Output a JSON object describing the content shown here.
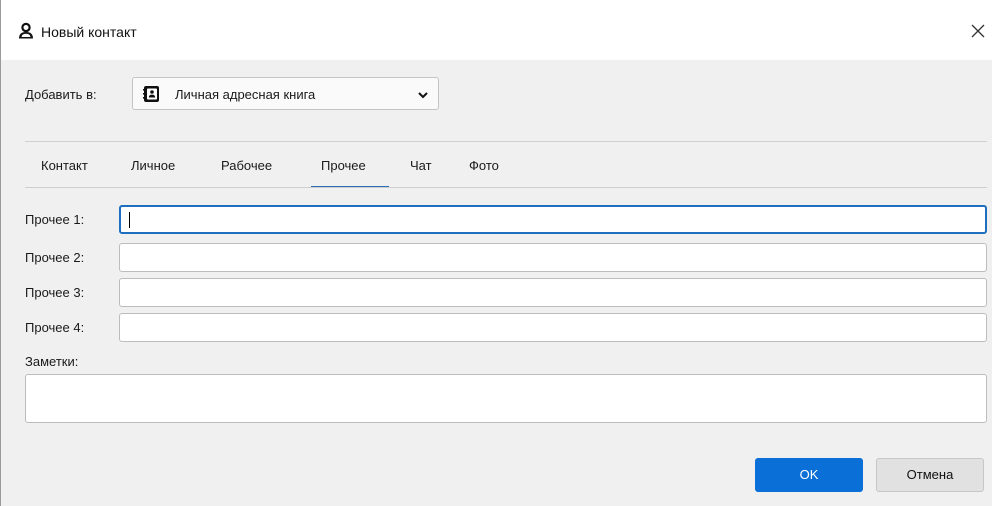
{
  "window": {
    "title": "Новый контакт",
    "icon": "person-icon"
  },
  "add_to": {
    "label": "Добавить в:",
    "value": "Личная адресная книга",
    "icon": "address-book-icon"
  },
  "tabs": [
    {
      "label": "Контакт",
      "selected": false
    },
    {
      "label": "Личное",
      "selected": false
    },
    {
      "label": "Рабочее",
      "selected": false
    },
    {
      "label": "Прочее",
      "selected": true
    },
    {
      "label": "Чат",
      "selected": false
    },
    {
      "label": "Фото",
      "selected": false
    }
  ],
  "fields": [
    {
      "label": "Прочее 1:",
      "value": "",
      "focused": true
    },
    {
      "label": "Прочее 2:",
      "value": "",
      "focused": false
    },
    {
      "label": "Прочее 3:",
      "value": "",
      "focused": false
    },
    {
      "label": "Прочее 4:",
      "value": "",
      "focused": false
    }
  ],
  "notes": {
    "label": "Заметки:",
    "value": ""
  },
  "buttons": {
    "ok": "OK",
    "cancel": "Отмена"
  },
  "colors": {
    "accent": "#0a6fd6",
    "tab_underline": "#2a6fb5",
    "focus_border": "#1f6fc0"
  }
}
